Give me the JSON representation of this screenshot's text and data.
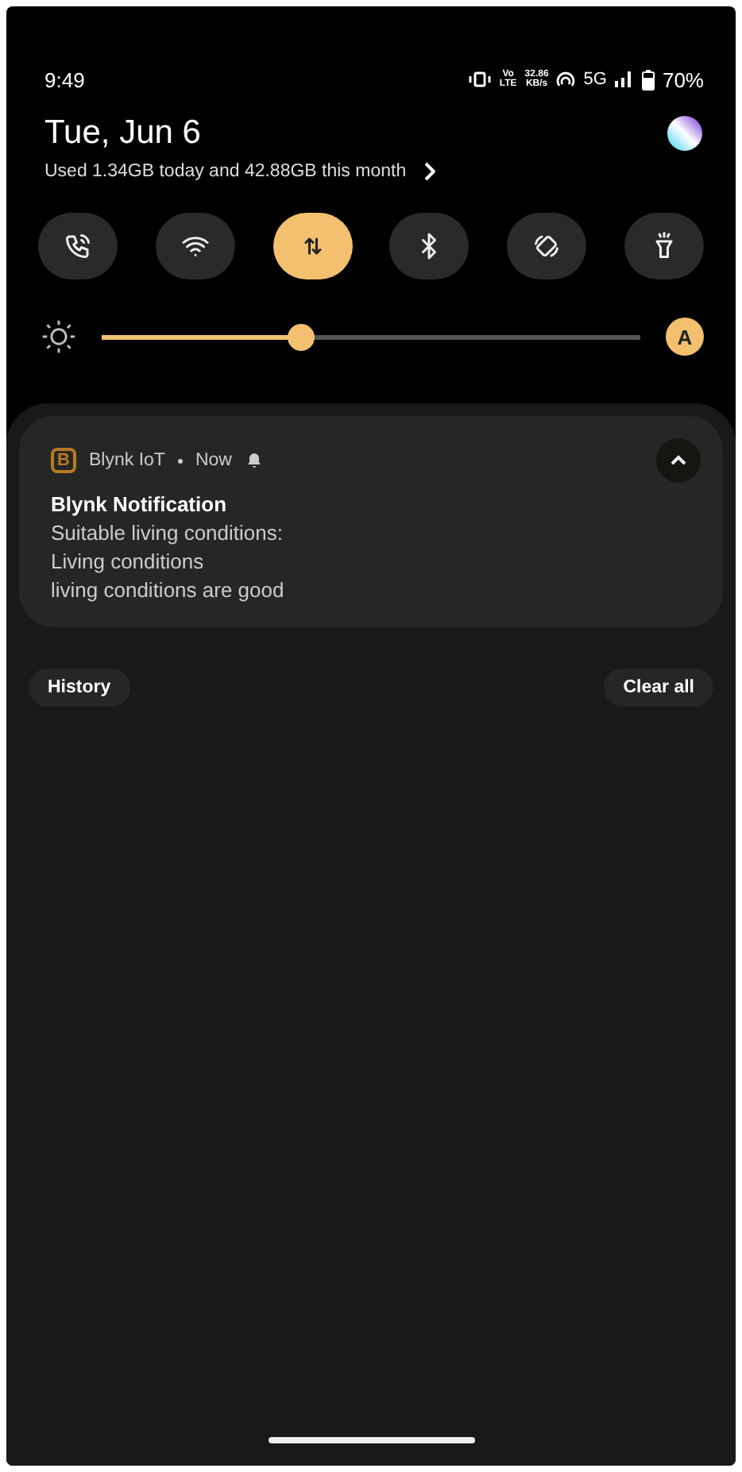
{
  "status_bar": {
    "time": "9:49",
    "volte_top": "Vo",
    "volte_bottom": "LTE",
    "speed_value": "32.86",
    "speed_unit": "KB/s",
    "network": "5G",
    "battery": "70%"
  },
  "header": {
    "date": "Tue, Jun 6",
    "data_usage": "Used 1.34GB today and 42.88GB this month"
  },
  "tiles": [
    {
      "kind": "calling",
      "selected": false
    },
    {
      "kind": "wifi",
      "selected": false
    },
    {
      "kind": "data",
      "selected": true
    },
    {
      "kind": "bluetooth",
      "selected": false
    },
    {
      "kind": "rotate",
      "selected": false
    },
    {
      "kind": "flashlight",
      "selected": false
    }
  ],
  "brightness": {
    "level": 0.37,
    "auto_label": "A",
    "auto": true
  },
  "notification": {
    "app_letter": "B",
    "app": "Blynk IoT",
    "time": "Now",
    "expanded": true,
    "title": "Blynk Notification",
    "lines": [
      "Suitable living conditions:",
      "Living conditions",
      "living conditions are good"
    ]
  },
  "buttons": [
    "History",
    "Clear all"
  ]
}
